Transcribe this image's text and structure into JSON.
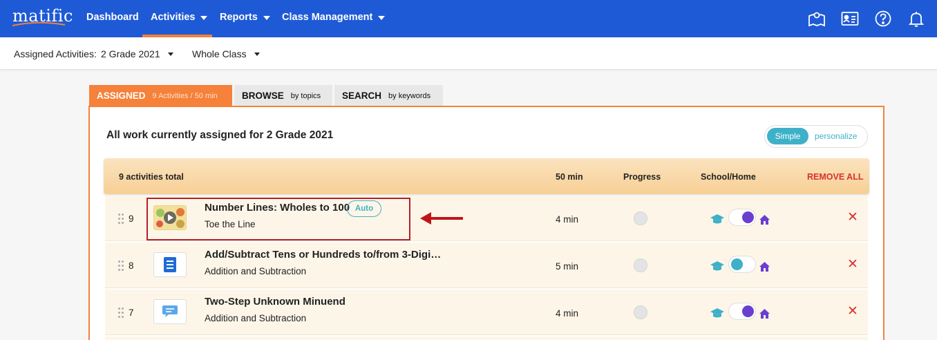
{
  "brand": {
    "logo": "matific"
  },
  "nav": {
    "items": [
      {
        "label": "Dashboard",
        "has_caret": false
      },
      {
        "label": "Activities",
        "has_caret": true
      },
      {
        "label": "Reports",
        "has_caret": true
      },
      {
        "label": "Class Management",
        "has_caret": true
      }
    ],
    "active": "Activities",
    "right_icons": [
      "map-icon",
      "id-card-icon",
      "help-icon",
      "bell-icon"
    ]
  },
  "subheader": {
    "label": "Assigned Activities:",
    "class_select": "2 Grade 2021",
    "group_select": "Whole Class"
  },
  "tabs": [
    {
      "main": "ASSIGNED",
      "sub": "9 Activities / 50 min",
      "active": true
    },
    {
      "main": "BROWSE",
      "sub": "by topics",
      "active": false
    },
    {
      "main": "SEARCH",
      "sub": "by keywords",
      "active": false
    }
  ],
  "panel": {
    "title": "All work currently assigned for 2 Grade 2021",
    "toggle": {
      "simple": "Simple",
      "personalize": "personalize",
      "selected": "Simple"
    }
  },
  "table": {
    "headers": {
      "count": "9 activities total",
      "time": "50 min",
      "progress": "Progress",
      "school_home": "School/Home",
      "remove_all": "REMOVE ALL"
    },
    "rows": [
      {
        "num": "9",
        "title": "Number Lines: Wholes to 100",
        "badge": "Auto",
        "subtitle": "Toe the Line",
        "minutes": "4 min",
        "thumb": "video-thumbnail",
        "mode": "home"
      },
      {
        "num": "8",
        "title": "Add/Subtract Tens or Hundreds to/from 3-Digi…",
        "badge": "",
        "subtitle": "Addition and Subtraction",
        "minutes": "5 min",
        "thumb": "worksheet-icon",
        "mode": "school"
      },
      {
        "num": "7",
        "title": "Two-Step Unknown Minuend",
        "badge": "",
        "subtitle": "Addition and Subtraction",
        "minutes": "4 min",
        "thumb": "word-problem-icon",
        "mode": "home"
      }
    ]
  },
  "colors": {
    "nav_bg": "#1f5ad6",
    "accent_orange": "#f5813a",
    "teal": "#3eb1c8",
    "purple": "#6a3fd0",
    "remove_red": "#d8322e",
    "annotation_red": "#b31f27"
  }
}
